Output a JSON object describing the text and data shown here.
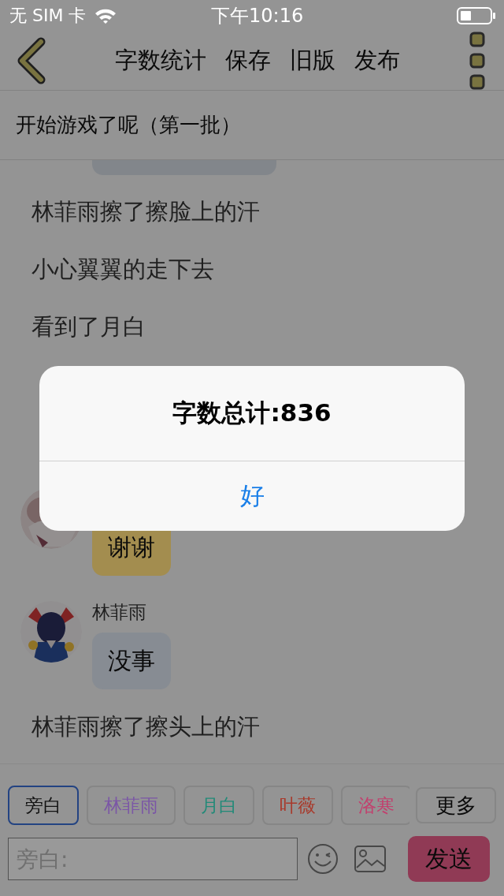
{
  "status_bar": {
    "carrier": "无 SIM 卡",
    "time": "下午10:16"
  },
  "toolbar": {
    "buttons": [
      "字数统计",
      "保存",
      "旧版",
      "发布"
    ]
  },
  "title": "开始游戏了呢（第一批）",
  "messages": [
    {
      "kind": "cut_bubble",
      "color": "#82868b"
    },
    {
      "kind": "narration",
      "text": "林菲雨擦了擦脸上的汗"
    },
    {
      "kind": "narration",
      "text": "小心翼翼的走下去"
    },
    {
      "kind": "narration",
      "text": "看到了月白"
    },
    {
      "kind": "covered"
    },
    {
      "kind": "covered"
    },
    {
      "kind": "speech",
      "text": "谢谢",
      "color": "#a38d4f"
    },
    {
      "kind": "speech",
      "name": "林菲雨",
      "text": "没事",
      "color": "#878c93"
    },
    {
      "kind": "narration",
      "text": "林菲雨擦了擦头上的汗"
    }
  ],
  "roles": [
    {
      "label": "旁白",
      "color": "#111111",
      "selected": true
    },
    {
      "label": "林菲雨",
      "color": "#7b56a6",
      "selected": false
    },
    {
      "label": "月白",
      "color": "#218a78",
      "selected": false
    },
    {
      "label": "叶薇",
      "color": "#a83a2c",
      "selected": false
    },
    {
      "label": "洛寒",
      "color": "#c2406e",
      "selected": false
    }
  ],
  "more": "更多",
  "input": {
    "placeholder": "旁白:"
  },
  "send": "发送",
  "alert": {
    "title": "字数总计:836",
    "button": "好"
  }
}
